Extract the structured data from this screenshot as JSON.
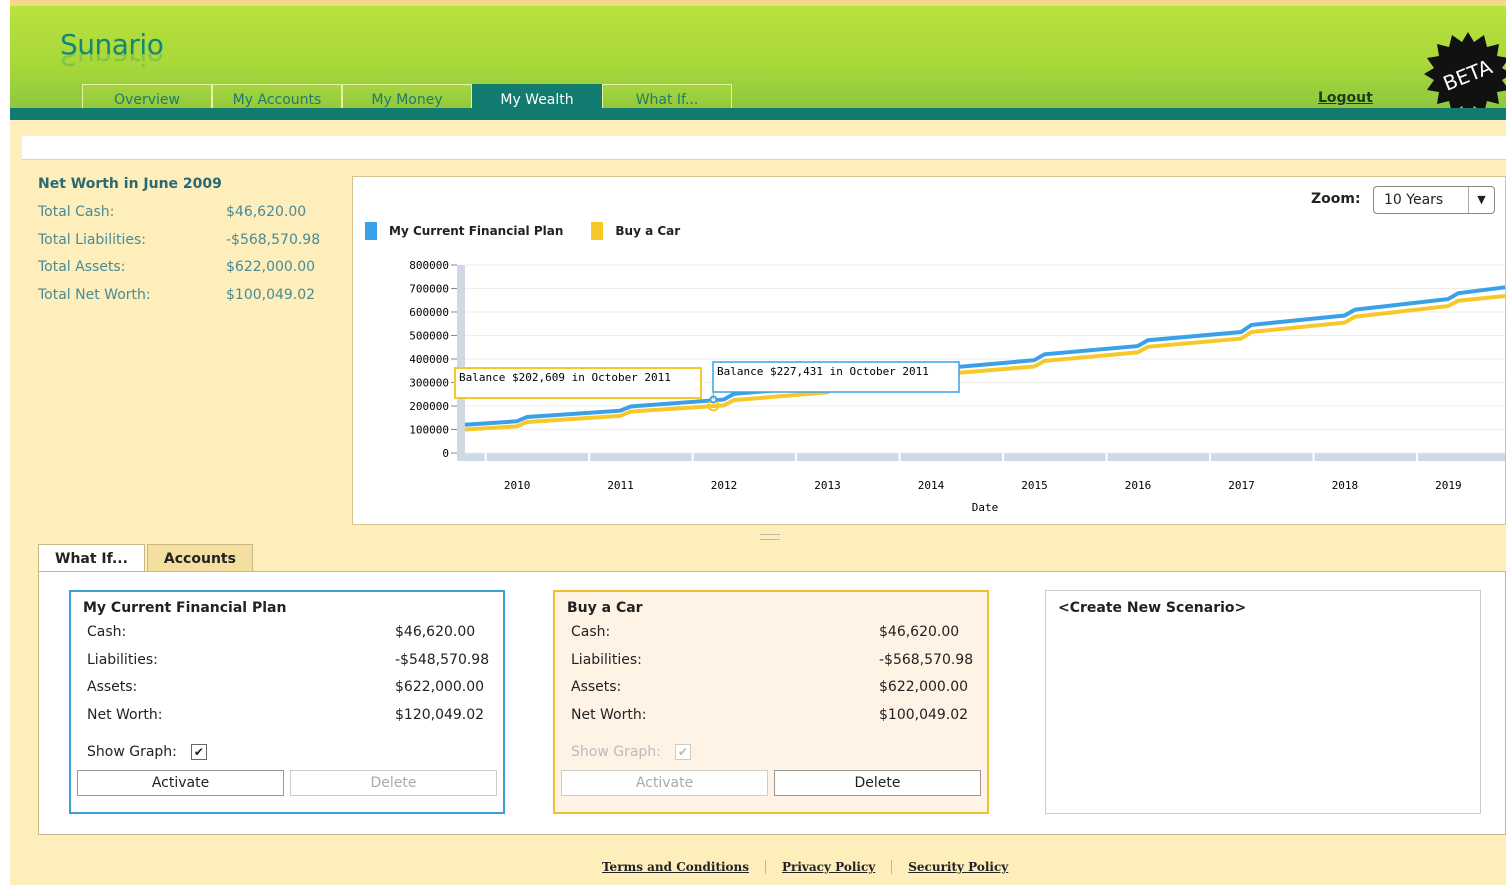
{
  "app": {
    "logo": "Sunario",
    "beta_badge": "BETA",
    "logout": "Logout"
  },
  "nav": {
    "tabs": [
      {
        "label": "Overview"
      },
      {
        "label": "My Accounts"
      },
      {
        "label": "My Money"
      },
      {
        "label": "My Wealth",
        "active": true
      },
      {
        "label": "What If..."
      }
    ]
  },
  "summary": {
    "title": "Net Worth in June 2009",
    "rows": [
      {
        "label": "Total Cash:",
        "value": "$46,620.00"
      },
      {
        "label": "Total Liabilities:",
        "value": "-$568,570.98"
      },
      {
        "label": "Total Assets:",
        "value": "$622,000.00"
      },
      {
        "label": "Total Net Worth:",
        "value": "$100,049.02"
      }
    ]
  },
  "zoom": {
    "label": "Zoom:",
    "selected": "10 Years"
  },
  "colors": {
    "plan_blue": "#3aa0e8",
    "car_yellow": "#f6c82a",
    "teal": "#127a6e"
  },
  "chart_data": {
    "type": "line",
    "xlabel": "Date",
    "ylabel": "",
    "x_ticks": [
      "2010",
      "2011",
      "2012",
      "2013",
      "2014",
      "2015",
      "2016",
      "2017",
      "2018",
      "2019"
    ],
    "y_ticks": [
      "0",
      "100000",
      "200000",
      "300000",
      "400000",
      "500000",
      "600000",
      "700000",
      "800000"
    ],
    "ylim": [
      0,
      800000
    ],
    "xlim": [
      2009.4,
      2019.45
    ],
    "series": [
      {
        "name": "My Current Financial Plan",
        "color": "#3aa0e8",
        "x": [
          2009.4,
          2009.9,
          2010.0,
          2010.9,
          2011.0,
          2011.9,
          2012.0,
          2012.9,
          2013.0,
          2013.9,
          2014.0,
          2014.9,
          2015.0,
          2015.9,
          2016.0,
          2016.9,
          2017.0,
          2017.9,
          2018.0,
          2018.9,
          2019.0,
          2019.45
        ],
        "values": [
          120049,
          135000,
          153000,
          180000,
          198000,
          227431,
          252000,
          285000,
          305000,
          330000,
          360000,
          395000,
          420000,
          455000,
          480000,
          515000,
          545000,
          585000,
          610000,
          655000,
          680000,
          705000
        ]
      },
      {
        "name": "Buy a Car",
        "color": "#f6c82a",
        "x": [
          2009.4,
          2009.9,
          2010.0,
          2010.9,
          2011.0,
          2011.9,
          2012.0,
          2012.9,
          2013.0,
          2013.9,
          2014.0,
          2014.9,
          2015.0,
          2015.9,
          2016.0,
          2016.9,
          2017.0,
          2017.9,
          2018.0,
          2018.9,
          2019.0,
          2019.45
        ],
        "values": [
          100049,
          113000,
          132000,
          158000,
          176000,
          202609,
          225000,
          258000,
          280000,
          305000,
          335000,
          368000,
          392000,
          428000,
          452000,
          487000,
          515000,
          555000,
          580000,
          625000,
          648000,
          668000
        ]
      }
    ],
    "annotations": [
      {
        "text": "Balance $202,609 in October 2011",
        "series": "Buy a Car"
      },
      {
        "text": "Balance $227,431 in October 2011",
        "series": "My Current Financial Plan"
      }
    ]
  },
  "bottom_tabs": [
    {
      "label": "What If...",
      "active": true
    },
    {
      "label": "Accounts"
    }
  ],
  "scenarios": [
    {
      "title": "My Current Financial Plan",
      "rows": [
        {
          "label": "Cash:",
          "value": "$46,620.00"
        },
        {
          "label": "Liabilities:",
          "value": "-$548,570.98"
        },
        {
          "label": "Assets:",
          "value": "$622,000.00"
        },
        {
          "label": "Net Worth:",
          "value": "$120,049.02"
        }
      ],
      "show_graph_label": "Show Graph:",
      "activate": "Activate",
      "delete": "Delete"
    },
    {
      "title": "Buy a Car",
      "rows": [
        {
          "label": "Cash:",
          "value": "$46,620.00"
        },
        {
          "label": "Liabilities:",
          "value": "-$568,570.98"
        },
        {
          "label": "Assets:",
          "value": "$622,000.00"
        },
        {
          "label": "Net Worth:",
          "value": "$100,049.02"
        }
      ],
      "show_graph_label": "Show Graph:",
      "activate": "Activate",
      "delete": "Delete"
    }
  ],
  "create_scenario": "<Create New Scenario>",
  "footer": {
    "links": [
      "Terms and Conditions",
      "Privacy Policy",
      "Security Policy"
    ]
  }
}
